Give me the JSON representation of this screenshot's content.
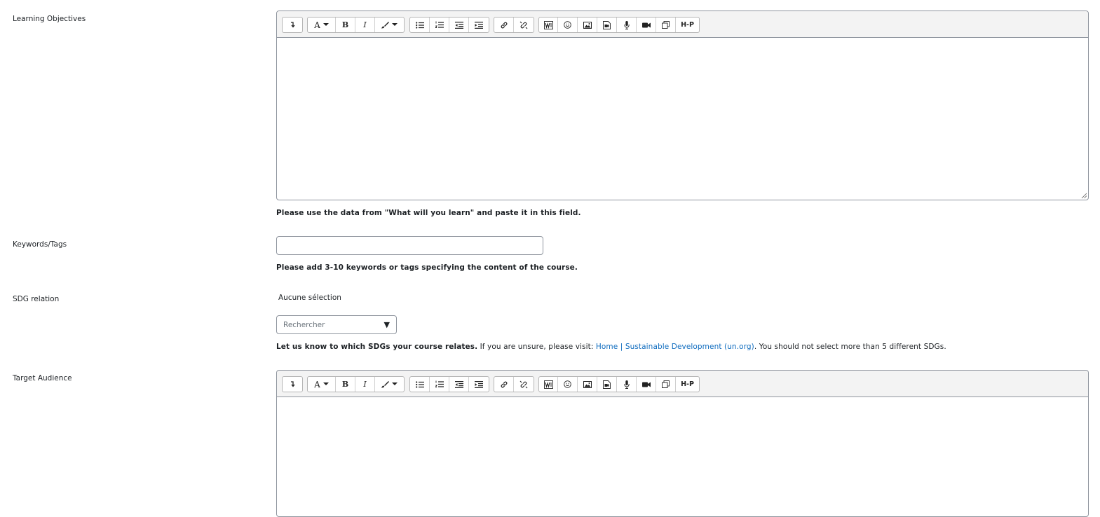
{
  "fields": {
    "learning_objectives": {
      "label": "Learning Objectives",
      "help": "Please use the data from \"What will you learn\" and paste it in this field."
    },
    "keywords": {
      "label": "Keywords/Tags",
      "value": "",
      "help": "Please add 3-10 keywords or tags specifying the content of the course."
    },
    "sdg": {
      "label": "SDG relation",
      "selection": "Aucune sélection",
      "search_placeholder": "Rechercher",
      "caret": "▼",
      "help_bold": "Let us know to which SDGs your course relates.",
      "help_text1": " If you are unsure, please visit: ",
      "help_link": "Home | Sustainable Development (un.org)",
      "help_text2": ". You should not select more than 5 different SDGs."
    },
    "target_audience": {
      "label": "Target Audience"
    }
  },
  "toolbar": {
    "font_letter": "A",
    "bold": "B",
    "italic": "I",
    "h5p": "H-P"
  },
  "icons": [
    "toggle-icon",
    "font-icon",
    "bold-icon",
    "italic-icon",
    "brush-icon",
    "unordered-list-icon",
    "ordered-list-icon",
    "indent-icon",
    "outdent-icon",
    "link-icon",
    "unlink-icon",
    "word-icon",
    "emoji-icon",
    "image-icon",
    "media-icon",
    "microphone-icon",
    "video-icon",
    "copy-icon",
    "h5p-icon"
  ]
}
